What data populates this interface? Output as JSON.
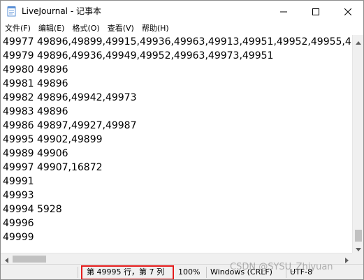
{
  "window": {
    "title": "LiveJournal - 记事本"
  },
  "titlebar": {
    "app_icon": "notepad-icon",
    "minimize_icon": "minimize-icon",
    "maximize_icon": "maximize-icon",
    "close_icon": "close-icon"
  },
  "menu": {
    "items": [
      "文件(F)",
      "编辑(E)",
      "格式(O)",
      "查看(V)",
      "帮助(H)"
    ]
  },
  "editor": {
    "lines": [
      "49977 49896,49899,49915,49936,49963,49913,49951,49952,49955,4",
      "49979 49896,49936,49949,49952,49963,49973,49951",
      "49980 49896",
      "49981 49896",
      "49982 49896,49942,49973",
      "49983 49896",
      "49986 49897,49927,49987",
      "49995 49902,49899",
      "49989 49906",
      "49997 49907,16872",
      "49991",
      "49993",
      "49994 5928",
      "49996",
      "49999"
    ]
  },
  "statusbar": {
    "position": "第 49995 行，第 7 列",
    "zoom": "100%",
    "line_ending": "Windows (CRLF)",
    "encoding": "UTF-8"
  },
  "watermark": {
    "text": "CSDN @SYSU_Zhiyuan"
  },
  "colors": {
    "highlight": "#e51c1c",
    "statusbar_bg": "#f0f0f0",
    "scrollbar_thumb": "#c1c1c1"
  }
}
